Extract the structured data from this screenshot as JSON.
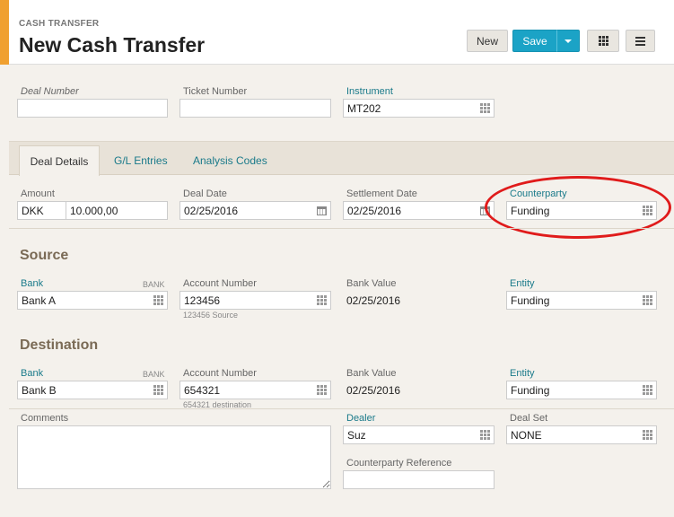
{
  "header": {
    "breadcrumb": "CASH TRANSFER",
    "title": "New Cash Transfer",
    "new_label": "New",
    "save_label": "Save"
  },
  "top_fields": {
    "deal_number_label": "Deal Number",
    "deal_number_value": "",
    "ticket_number_label": "Ticket Number",
    "ticket_number_value": "",
    "instrument_label": "Instrument",
    "instrument_value": "MT202"
  },
  "tabs": [
    {
      "label": "Deal Details",
      "active": true
    },
    {
      "label": "G/L Entries",
      "active": false
    },
    {
      "label": "Analysis Codes",
      "active": false
    }
  ],
  "deal_details": {
    "amount_label": "Amount",
    "currency": "DKK",
    "amount": "10.000,00",
    "deal_date_label": "Deal Date",
    "deal_date": "02/25/2016",
    "settlement_date_label": "Settlement Date",
    "settlement_date": "02/25/2016",
    "counterparty_label": "Counterparty",
    "counterparty": "Funding"
  },
  "source": {
    "title": "Source",
    "bank_label": "Bank",
    "bank_tag": "BANK",
    "bank": "Bank A",
    "account_label": "Account Number",
    "account": "123456",
    "account_hint": "123456 Source",
    "bank_value_label": "Bank Value",
    "bank_value": "02/25/2016",
    "entity_label": "Entity",
    "entity": "Funding"
  },
  "destination": {
    "title": "Destination",
    "bank_label": "Bank",
    "bank_tag": "BANK",
    "bank": "Bank B",
    "account_label": "Account Number",
    "account": "654321",
    "account_hint": "654321 destination",
    "bank_value_label": "Bank Value",
    "bank_value": "02/25/2016",
    "entity_label": "Entity",
    "entity": "Funding"
  },
  "bottom": {
    "comments_label": "Comments",
    "comments": "",
    "dealer_label": "Dealer",
    "dealer": "Suz",
    "deal_set_label": "Deal Set",
    "deal_set": "NONE",
    "cp_ref_label": "Counterparty Reference",
    "cp_ref": ""
  },
  "colors": {
    "accent": "#f0a030",
    "primary_button": "#1ba3c6",
    "link_label": "#1a7a8a",
    "annotation": "#e01b1b"
  }
}
